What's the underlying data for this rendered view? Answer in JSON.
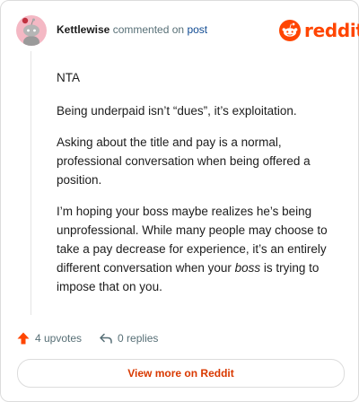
{
  "header": {
    "author": "Kettlewise",
    "action": "commented on",
    "target": "post"
  },
  "brand": {
    "wordmark": "reddit",
    "color": "#ff4500"
  },
  "comment": {
    "paragraphs": [
      "NTA",
      "Being underpaid isn’t “dues”, it’s exploitation.",
      "Asking about the title and pay is a normal, professional conversation when being offered a position.",
      {
        "before": "I’m hoping your boss maybe realizes he’s being unprofessional. While many people may choose to take a pay decrease for experience, it’s an entirely different conversation when your ",
        "emphasis": "boss",
        "after": " is trying to impose that on you."
      }
    ]
  },
  "actions": {
    "upvotes": "4 upvotes",
    "replies": "0 replies",
    "upvote_color": "#ff4500"
  },
  "cta": {
    "label": "View more on Reddit",
    "color": "#d93900"
  },
  "icons": [
    "reddit-snoo-avatar",
    "reddit-logo-icon",
    "upvote-arrow-icon",
    "reply-arrow-icon"
  ]
}
